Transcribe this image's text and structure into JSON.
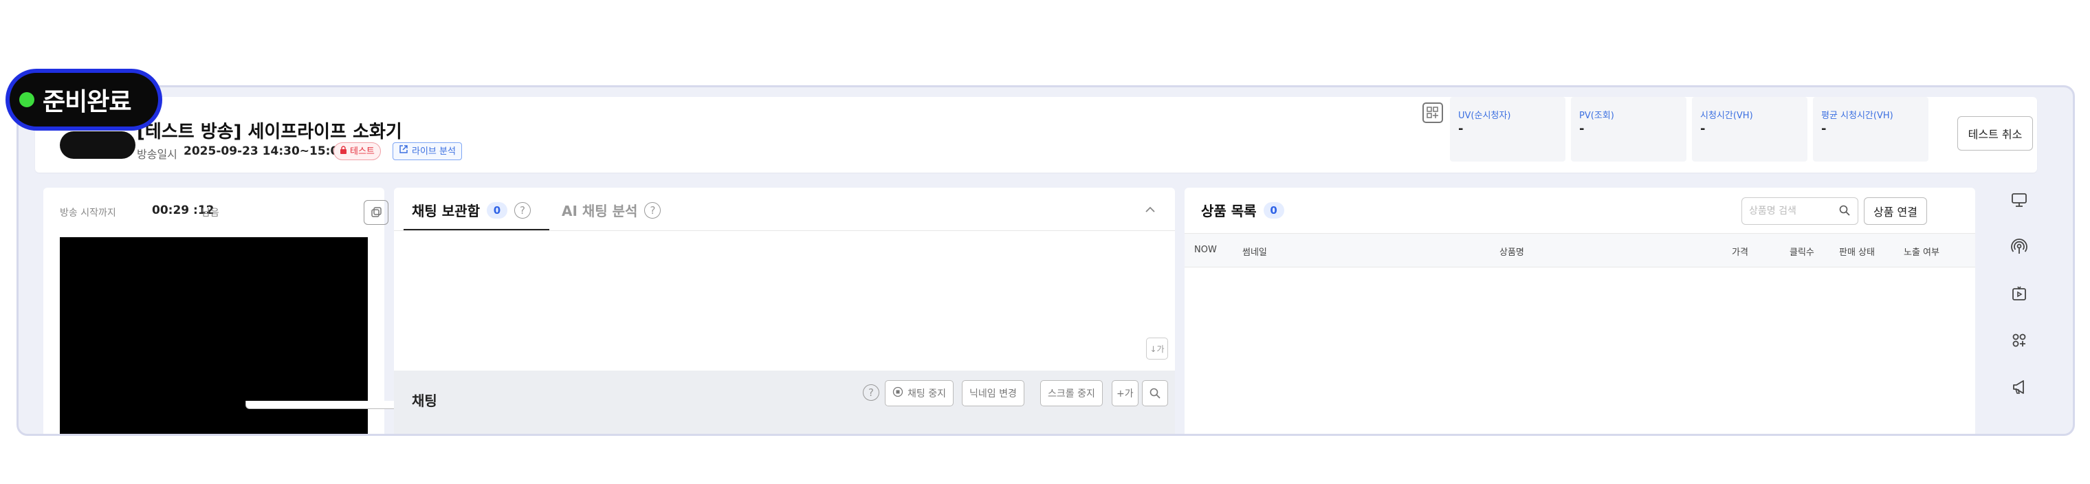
{
  "status": {
    "label": "준비완료",
    "dot_color": "#3ddc3d"
  },
  "header": {
    "title": "[테스트 방송] 세이프라이프 소화기",
    "date_label": "방송일시",
    "date_value": "2025-09-23 14:30~15:00",
    "tag_test": "테스트",
    "tag_live_analysis": "라이브 분석",
    "stats": [
      {
        "label": "UV(순시청자)",
        "value": "-"
      },
      {
        "label": "PV(조회)",
        "value": "-"
      },
      {
        "label": "시청시간(VH)",
        "value": "-"
      },
      {
        "label": "평균 시청시간(VH)",
        "value": "-"
      }
    ],
    "cancel_test_button": "테스트 취소"
  },
  "video": {
    "countdown_label": "방송 시작까지",
    "countdown_value": "00:29 :12",
    "countdown_suffix": "남음"
  },
  "chat": {
    "tab_archive": "채팅 보관함",
    "tab_archive_count": "0",
    "tab_ai": "AI 채팅 분석",
    "jump_button": "↓가",
    "footer_title": "채팅",
    "btn_stop_chat": "채팅 중지",
    "btn_change_nickname": "닉네임 변경",
    "btn_stop_scroll": "스크롤 중지",
    "btn_font": "+가"
  },
  "products": {
    "title": "상품 목록",
    "count": "0",
    "search_placeholder": "상품명 검색",
    "link_button": "상품 연결",
    "columns": [
      "NOW",
      "썸네일",
      "상품명",
      "가격",
      "클릭수",
      "판매 상태",
      "노출 여부"
    ]
  },
  "rail_icons": [
    "monitor-icon",
    "broadcast-icon",
    "play-tv-icon",
    "apps-add-icon",
    "megaphone-icon"
  ]
}
